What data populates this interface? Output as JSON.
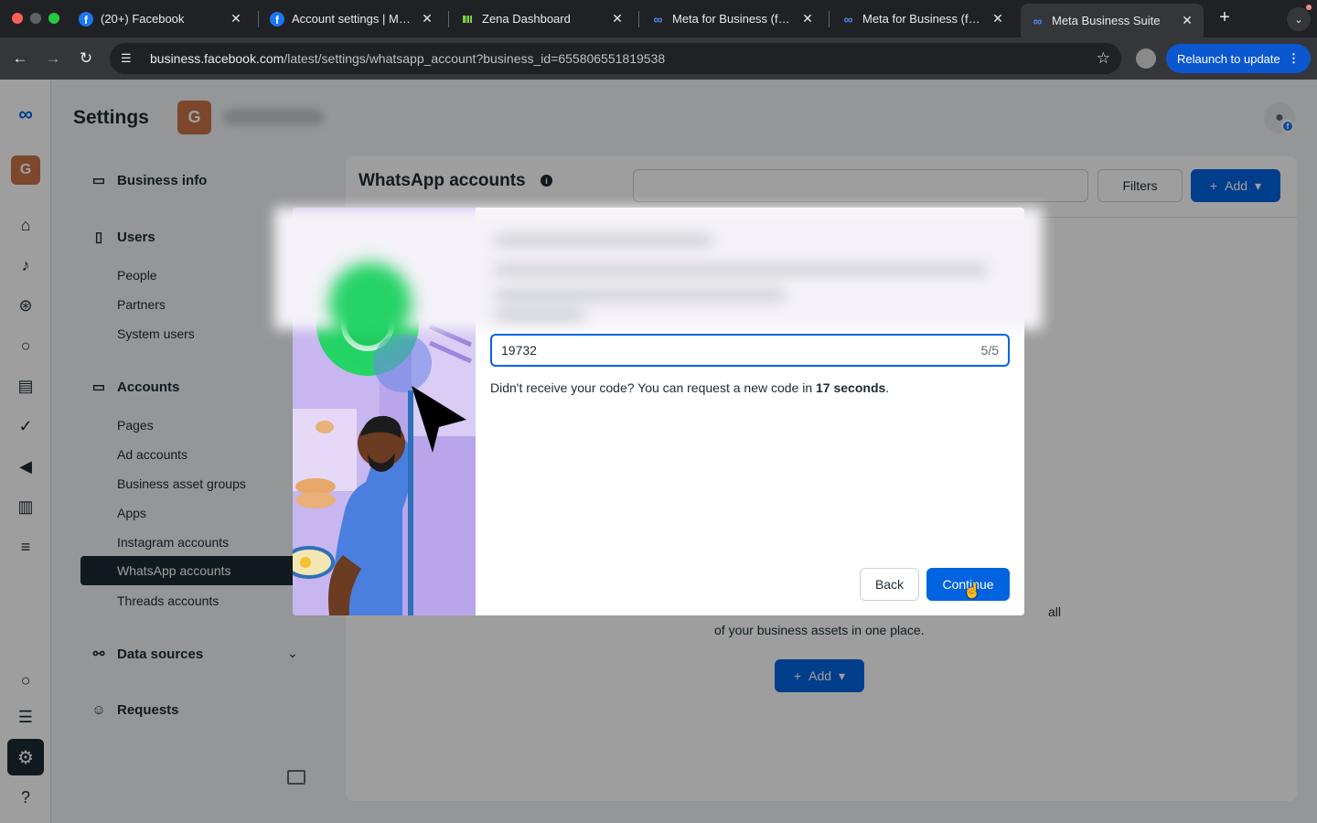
{
  "browser": {
    "tabs": [
      {
        "title": "(20+) Facebook",
        "icon": "facebook-icon"
      },
      {
        "title": "Account settings | Meta",
        "icon": "facebook-icon"
      },
      {
        "title": "Zena Dashboard",
        "icon": "zena-icon"
      },
      {
        "title": "Meta for Business (form",
        "icon": "meta-icon"
      },
      {
        "title": "Meta for Business (form",
        "icon": "meta-icon"
      },
      {
        "title": "Meta Business Suite",
        "icon": "meta-icon"
      }
    ],
    "url_host": "business.facebook.com",
    "url_path": "/latest/settings/whatsapp_account?business_id=655806551819538",
    "relaunch_label": "Relaunch to update"
  },
  "header": {
    "title": "Settings",
    "business_initial": "G",
    "rail_initial": "G"
  },
  "nav": {
    "business_info": "Business info",
    "users": "Users",
    "people": "People",
    "partners": "Partners",
    "system_users": "System users",
    "accounts": "Accounts",
    "pages": "Pages",
    "ad_accounts": "Ad accounts",
    "business_asset_groups": "Business asset groups",
    "apps": "Apps",
    "instagram_accounts": "Instagram accounts",
    "whatsapp_accounts": "WhatsApp accounts",
    "threads_accounts": "Threads accounts",
    "data_sources": "Data sources",
    "requests": "Requests"
  },
  "content": {
    "title": "WhatsApp accounts",
    "filters_label": "Filters",
    "add_label": "Add",
    "empty_line1": "all",
    "empty_line2": "of your business assets in one place.",
    "empty_add_label": "Add"
  },
  "modal": {
    "code_value": "19732",
    "code_counter": "5/5",
    "resend_prefix": "Didn't receive your code? You can request a new code in ",
    "resend_time": "17 seconds",
    "resend_suffix": ".",
    "back_label": "Back",
    "continue_label": "Continue"
  },
  "colors": {
    "brand_blue": "#0064e0",
    "sidebar_active": "#1c2b33",
    "business_avatar": "#c9734a"
  }
}
